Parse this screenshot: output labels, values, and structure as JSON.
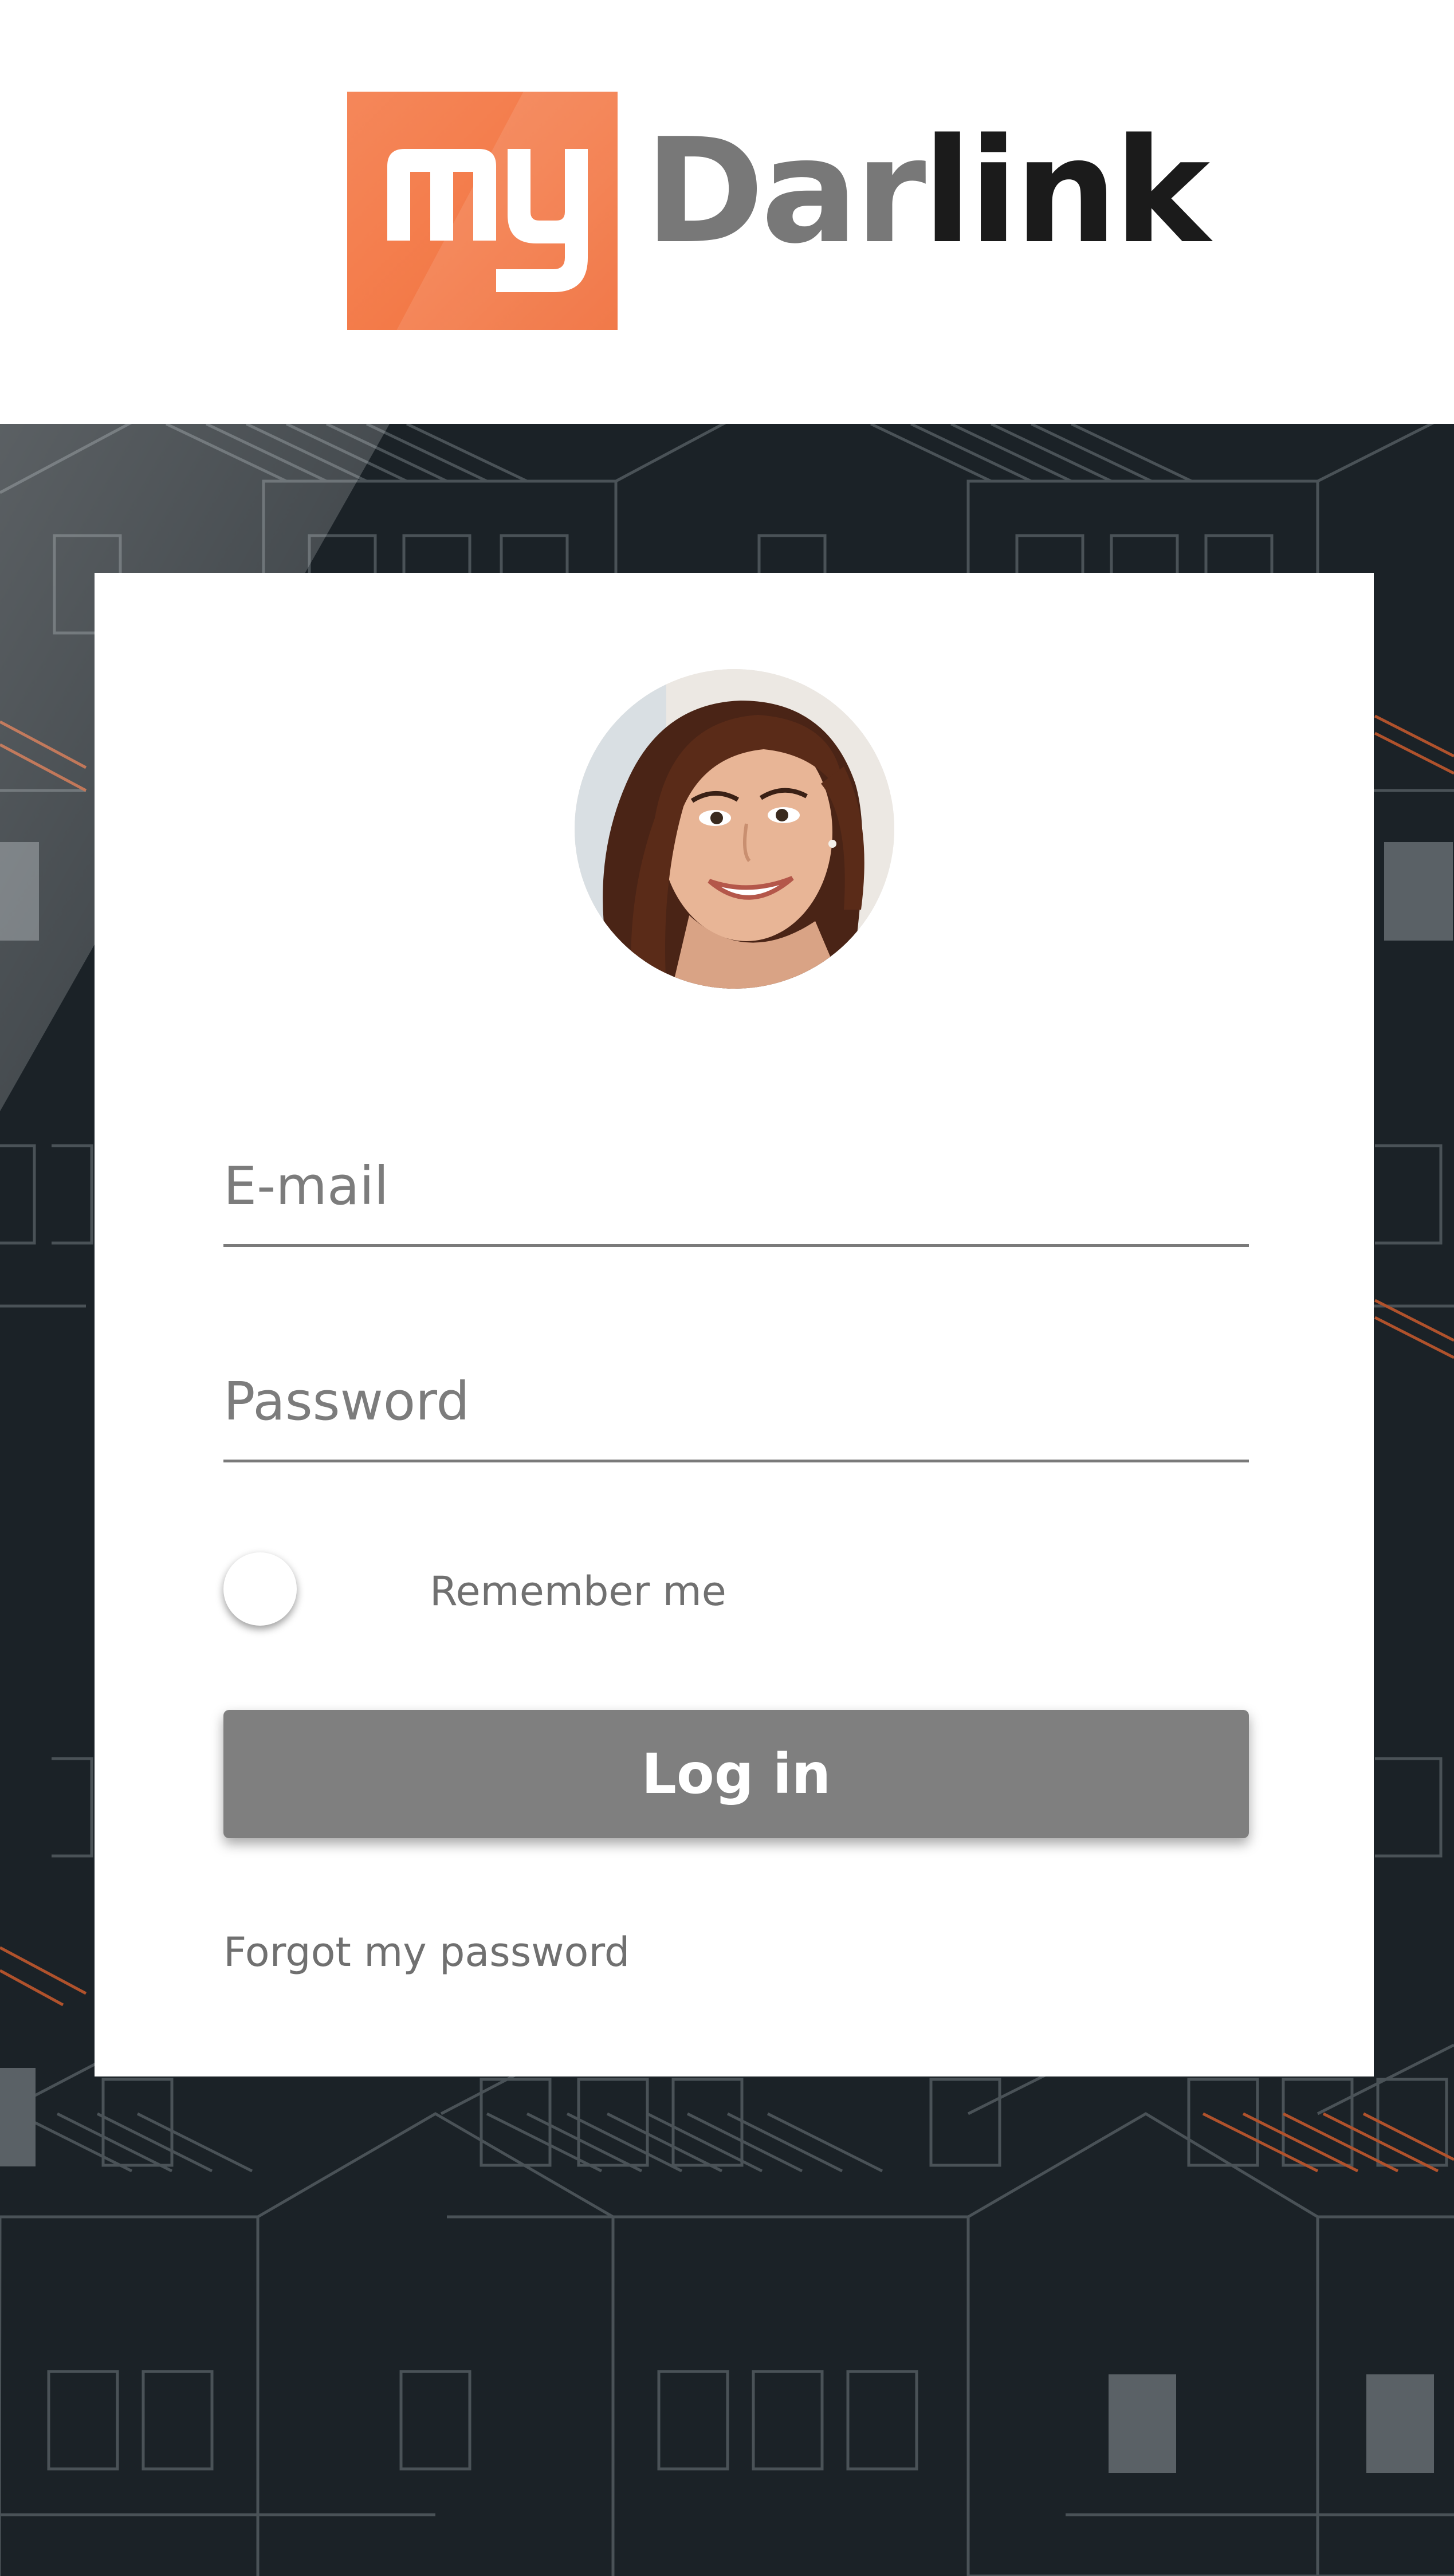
{
  "brand": {
    "mark_text": "my",
    "name_light": "Dar",
    "name_dark": "link"
  },
  "login": {
    "email_placeholder": "E-mail",
    "password_placeholder": "Password",
    "remember_label": "Remember me",
    "remember_checked": false,
    "login_button": "Log in",
    "forgot_link": "Forgot my password"
  },
  "colors": {
    "accent_orange": "#f37a48",
    "background_dark": "#1b2227",
    "button_gray": "#7f7f7f",
    "line_gray": "#7a7a7a"
  },
  "icons": [
    "user-avatar-photo"
  ]
}
